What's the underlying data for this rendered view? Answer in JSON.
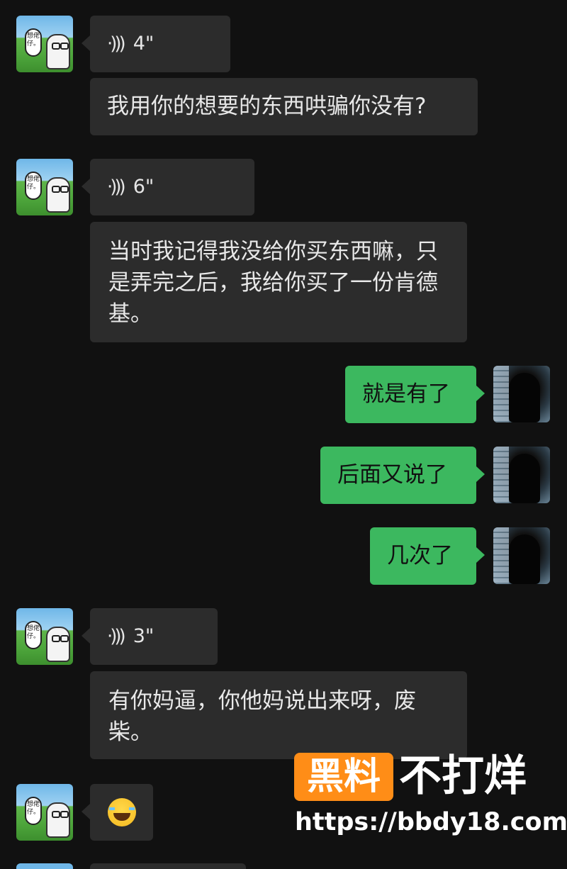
{
  "messages": [
    {
      "side": "left",
      "type": "voice",
      "duration": "4\""
    },
    {
      "side": "left",
      "type": "text",
      "text": "我用你的想要的东西哄骗你没有?"
    },
    {
      "side": "left",
      "type": "voice",
      "duration": "6\""
    },
    {
      "side": "left",
      "type": "text",
      "text": "当时我记得我没给你买东西嘛，只是弄完之后，我给你买了一份肯德基。"
    },
    {
      "side": "right",
      "type": "text",
      "text": "就是有了"
    },
    {
      "side": "right",
      "type": "text",
      "text": "后面又说了"
    },
    {
      "side": "right",
      "type": "text",
      "text": "几次了"
    },
    {
      "side": "left",
      "type": "voice",
      "duration": "3\""
    },
    {
      "side": "left",
      "type": "text",
      "text": "有你妈逼，你他妈说出来呀，废柴。"
    },
    {
      "side": "left",
      "type": "emoji",
      "emoji": "tears-of-joy-emoji"
    }
  ],
  "avatar_left": {
    "caption": "想佬仔。"
  },
  "watermark": {
    "brand": "黑料",
    "slogan": "不打烊",
    "url": "https://bbdy18.com",
    "brand_color": "#ff8d17"
  },
  "colors": {
    "background": "#111111",
    "incoming_bubble": "#2c2c2c",
    "outgoing_bubble": "#3cb85f"
  }
}
